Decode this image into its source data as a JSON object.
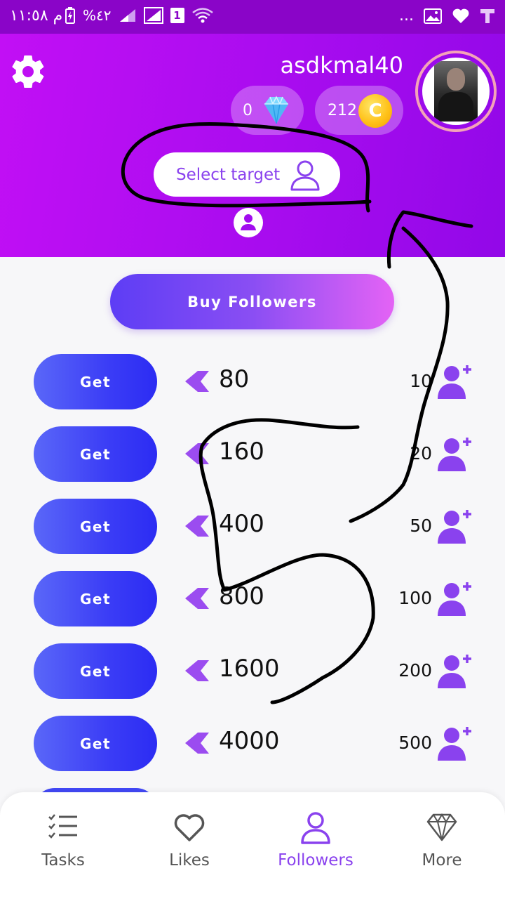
{
  "status_bar": {
    "time": "م ١١:٥٨",
    "battery": "%٤٢",
    "sim_badge": "1",
    "overflow": "..."
  },
  "header": {
    "username": "asdkmal40",
    "gems": "0",
    "coins": "212",
    "coin_symbol": "C",
    "select_target_label": "Select target"
  },
  "buy_followers_label": "Buy Followers",
  "offers": [
    {
      "button": "Get",
      "price": "80",
      "followers": "10"
    },
    {
      "button": "Get",
      "price": "160",
      "followers": "20"
    },
    {
      "button": "Get",
      "price": "400",
      "followers": "50"
    },
    {
      "button": "Get",
      "price": "800",
      "followers": "100"
    },
    {
      "button": "Get",
      "price": "1600",
      "followers": "200"
    },
    {
      "button": "Get",
      "price": "4000",
      "followers": "500"
    }
  ],
  "bottom_nav": [
    {
      "label": "Tasks",
      "icon": "tasks-list-icon",
      "active": false
    },
    {
      "label": "Likes",
      "icon": "heart-icon",
      "active": false
    },
    {
      "label": "Followers",
      "icon": "user-icon",
      "active": true
    },
    {
      "label": "More",
      "icon": "diamond-icon",
      "active": false
    }
  ],
  "colors": {
    "header_start": "#c20ff5",
    "header_end": "#9208e8",
    "accent": "#8a42ee",
    "get_button": "#3b3df6"
  }
}
